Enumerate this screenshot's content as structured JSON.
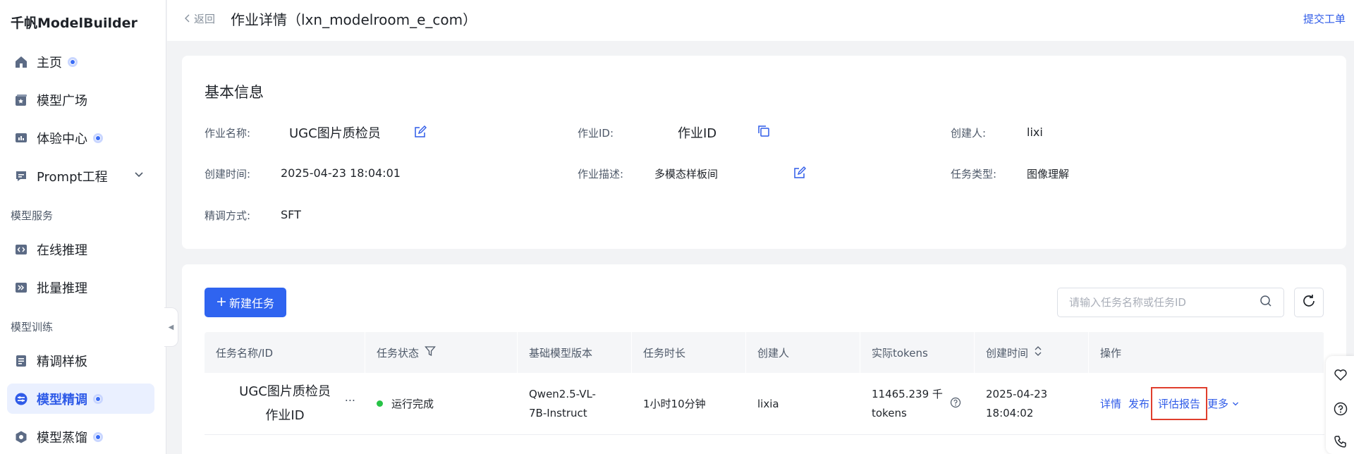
{
  "brand": "千帆ModelBuilder",
  "sidebar": {
    "items": [
      {
        "label": "主页",
        "badge": true
      },
      {
        "label": "模型广场",
        "badge": false
      },
      {
        "label": "体验中心",
        "badge": true
      },
      {
        "label": "Prompt工程",
        "badge": false
      }
    ],
    "section_service": "模型服务",
    "service_items": [
      {
        "label": "在线推理"
      },
      {
        "label": "批量推理"
      }
    ],
    "section_train": "模型训练",
    "train_items": [
      {
        "label": "精调样板"
      },
      {
        "label": "模型精调",
        "badge": true,
        "active": true
      },
      {
        "label": "模型蒸馏",
        "badge": true
      }
    ]
  },
  "header": {
    "back_label": "返回",
    "title": "作业详情（lxn_modelroom_e_com）",
    "ticket_link": "提交工单"
  },
  "basic_info": {
    "title": "基本信息",
    "job_name_label": "作业名称:",
    "job_name": "UGC图片质检员",
    "job_id_label": "作业ID:",
    "job_id": "作业ID",
    "creator_label": "创建人:",
    "creator": "lixi",
    "created_label": "创建时间:",
    "created": "2025-04-23 18:04:01",
    "desc_label": "作业描述:",
    "desc": "多模态样板间",
    "task_type_label": "任务类型:",
    "task_type": "图像理解",
    "tune_label": "精调方式:",
    "tune": "SFT"
  },
  "tasks": {
    "new_button": "新建任务",
    "search_placeholder": "请输入任务名称或任务ID",
    "columns": [
      "任务名称/ID",
      "任务状态",
      "基础模型版本",
      "任务时长",
      "创建人",
      "实际tokens",
      "创建时间",
      "操作"
    ],
    "rows": [
      {
        "name": "UGC图片质检员",
        "id": "作业ID",
        "more": "...",
        "status": "运行完成",
        "model_line1": "Qwen2.5-VL-",
        "model_line2": "7B-Instruct",
        "duration": "1小时10分钟",
        "creator": "lixia",
        "tokens_line1": "11465.239 千",
        "tokens_line2": "tokens",
        "created_line1": "2025-04-23",
        "created_line2": "18:04:02",
        "actions": {
          "detail": "详情",
          "publish": "发布",
          "report": "评估报告",
          "more": "更多"
        }
      }
    ]
  },
  "colors": {
    "accent": "#2f64f0",
    "success": "#27c346",
    "highlight": "#e03e2d"
  }
}
